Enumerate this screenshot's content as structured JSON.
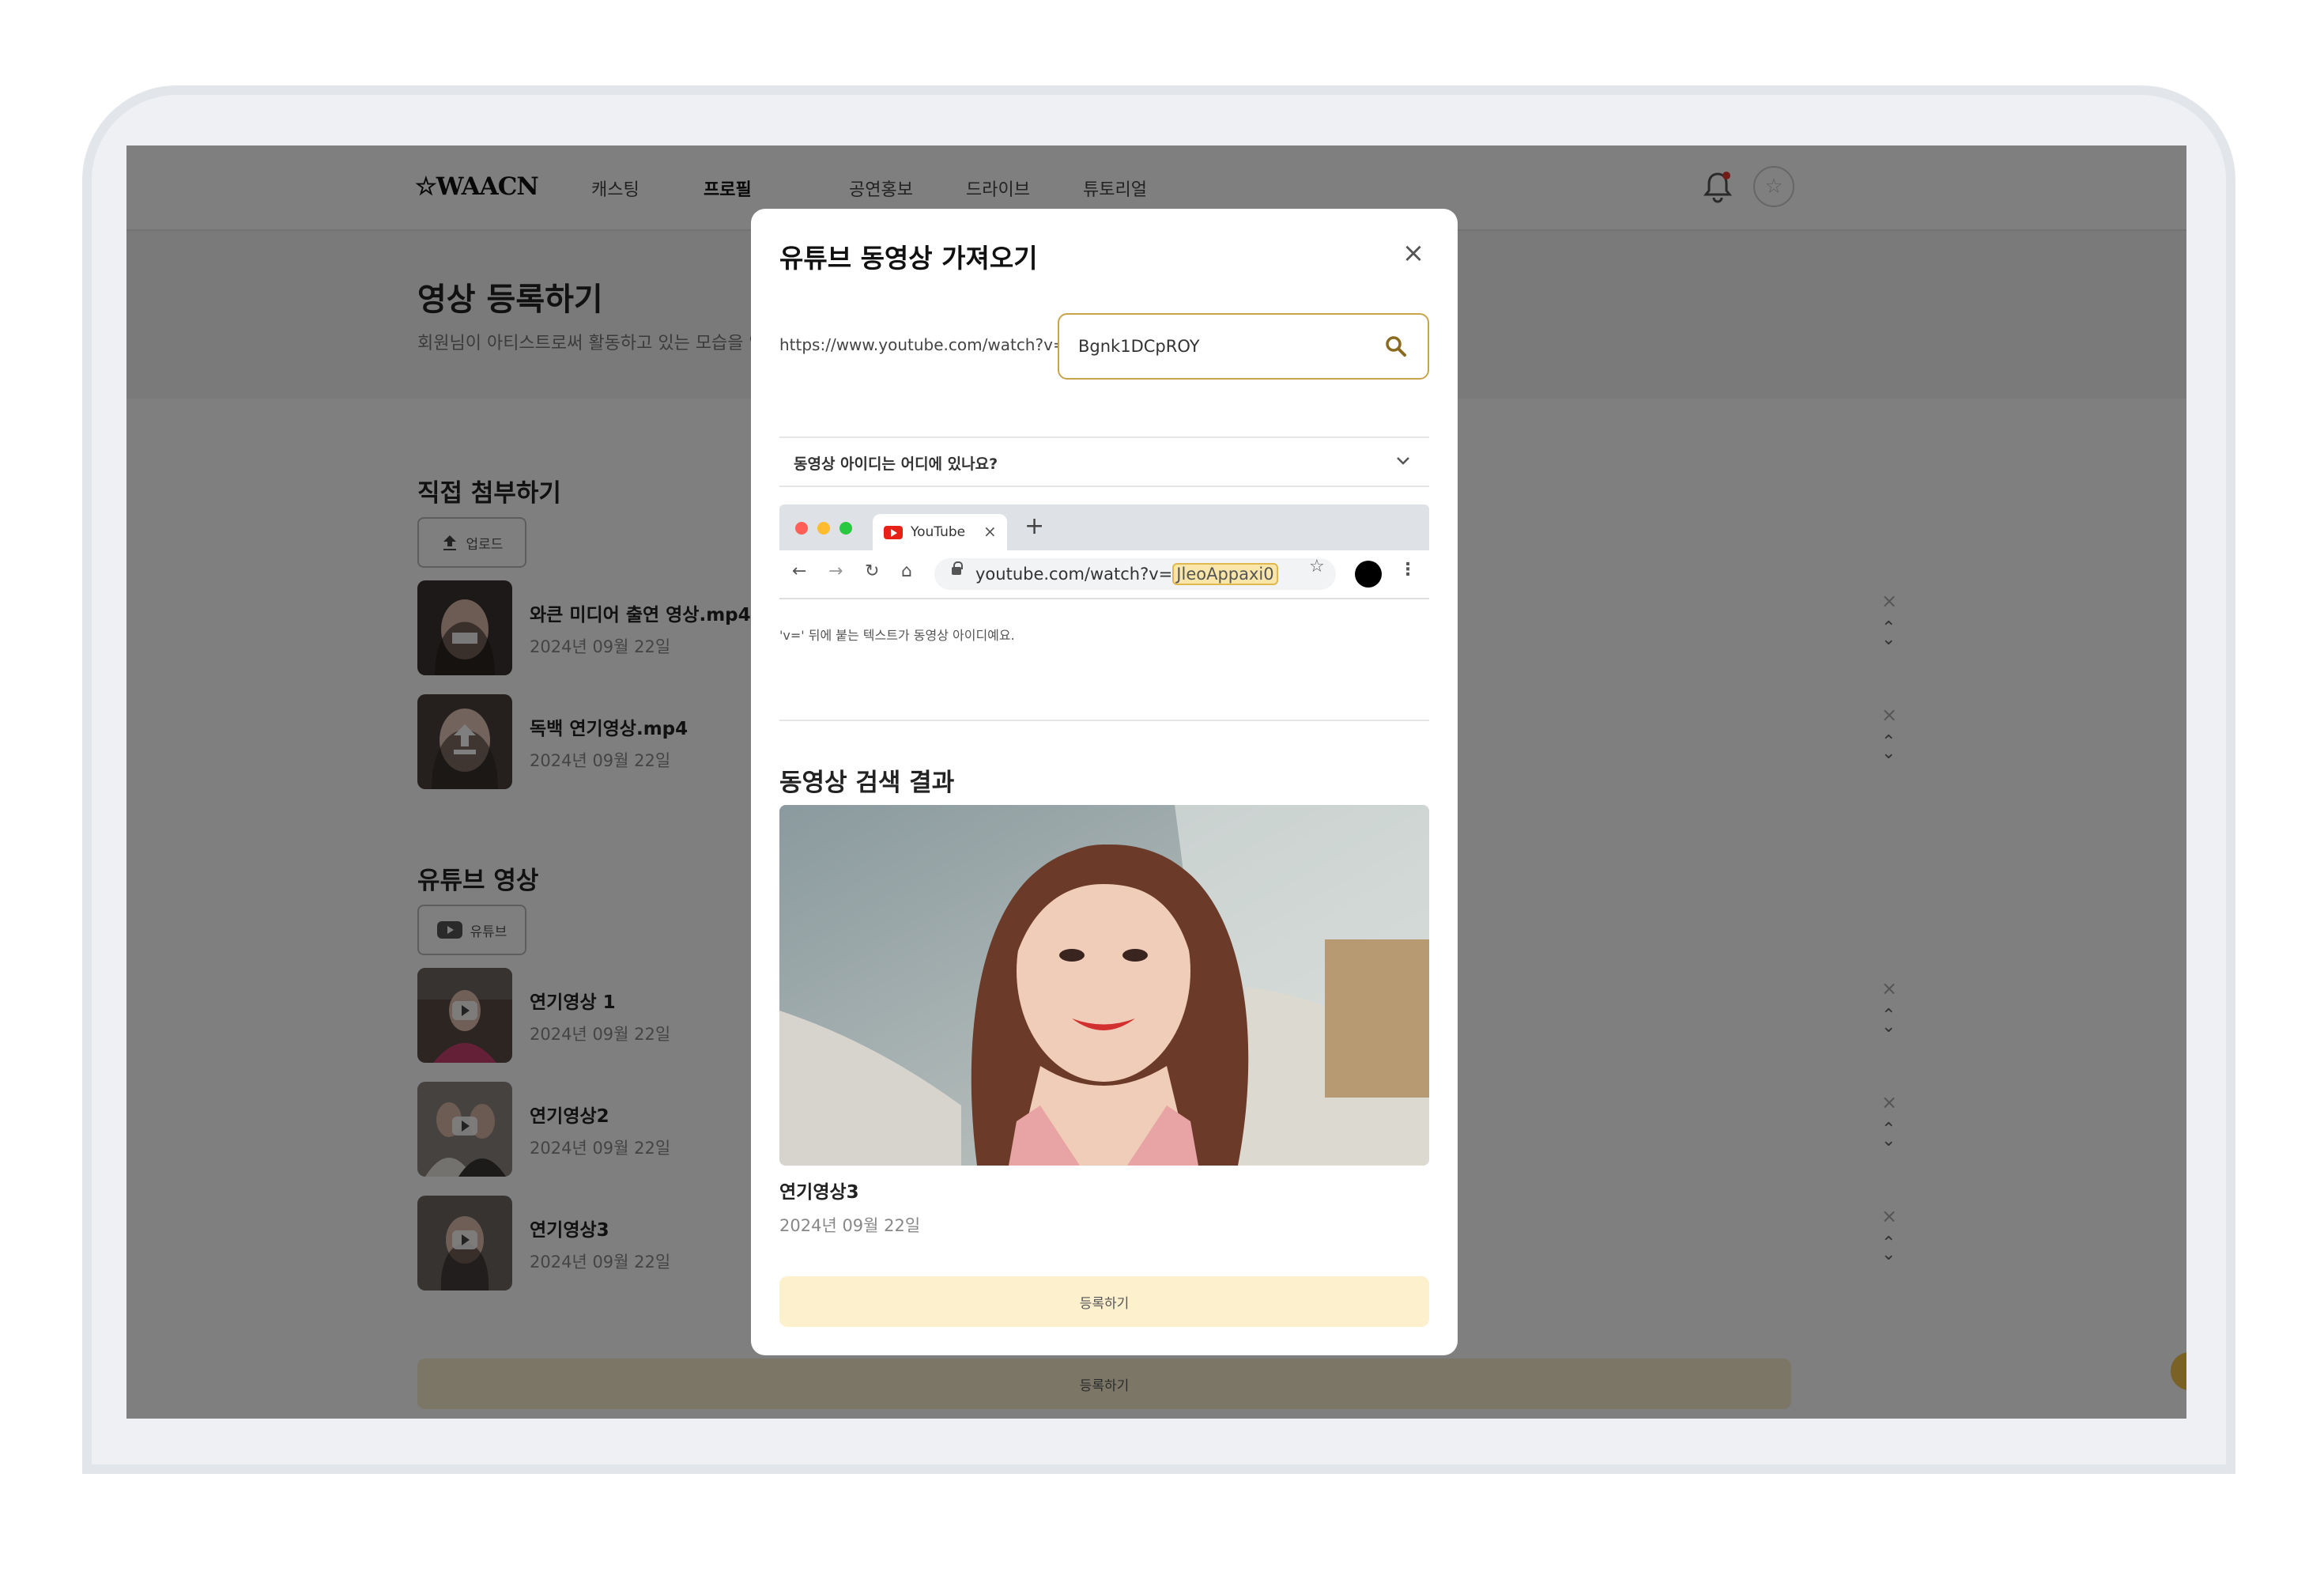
{
  "nav": {
    "logo": "☆WAACN",
    "items": [
      "캐스팅",
      "프로필",
      "공연홍보",
      "드라이브",
      "튜토리얼"
    ],
    "active_index": 1
  },
  "page": {
    "title": "영상 등록하기",
    "subtitle": "회원님이 아티스트로써 활동하고 있는 모습을 영"
  },
  "direct": {
    "title": "직접 첨부하기",
    "button_label": "업로드",
    "items": [
      {
        "title": "와큰 미디어 출연 영상.mp4",
        "date": "2024년 09월 22일"
      },
      {
        "title": "독백 연기영상.mp4",
        "date": "2024년 09월 22일"
      }
    ]
  },
  "youtube": {
    "title": "유튜브 영상",
    "button_label": "유튜브",
    "items": [
      {
        "title": "연기영상 1",
        "date": "2024년 09월 22일"
      },
      {
        "title": "연기영상2",
        "date": "2024년 09월 22일"
      },
      {
        "title": "연기영상3",
        "date": "2024년 09월 22일"
      }
    ]
  },
  "bottom_button": "등록하기",
  "modal": {
    "title": "유튜브 동영상 가져오기",
    "url_prefix": "https://www.youtube.com/watch?v=",
    "input_value": "Bgnk1DCpROY",
    "faq_label": "동영상 아이디는 어디에 있나요?",
    "browser": {
      "tab_label": "YouTube",
      "address_prefix": "youtube.com/watch?v=",
      "address_id": "JleoAppaxi0"
    },
    "hint": "'v=' 뒤에 붙는 텍스트가 동영상 아이디예요.",
    "result_title": "동영상 검색 결과",
    "result_name": "연기영상3",
    "result_date": "2024년 09월 22일",
    "register_label": "등록하기"
  },
  "colors": {
    "accent_border": "#c9a34a",
    "register_bg": "#fdf0cd",
    "notification_dot": "#e53935"
  }
}
